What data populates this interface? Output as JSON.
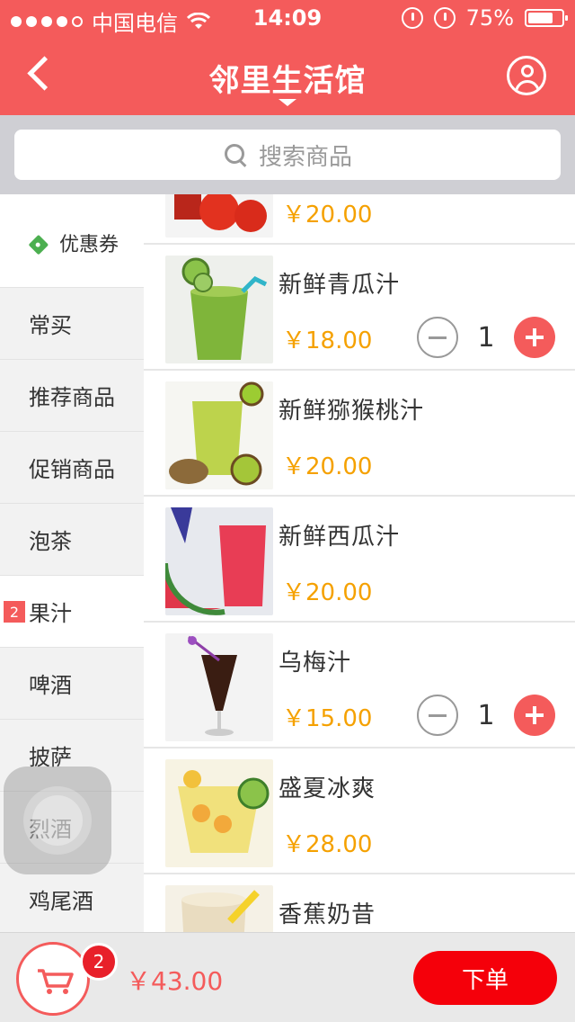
{
  "status_bar": {
    "carrier": "中国电信",
    "time": "14:09",
    "battery": "75%",
    "battery_level": 0.75
  },
  "nav": {
    "title": "邻里生活馆"
  },
  "search": {
    "placeholder": "搜索商品"
  },
  "sidebar": {
    "coupon_label": "优惠券",
    "items": [
      {
        "label": "常买",
        "badge": ""
      },
      {
        "label": "推荐商品",
        "badge": ""
      },
      {
        "label": "促销商品",
        "badge": ""
      },
      {
        "label": "泡茶",
        "badge": ""
      },
      {
        "label": "果汁",
        "badge": "2",
        "active": true
      },
      {
        "label": "啤酒",
        "badge": ""
      },
      {
        "label": "披萨",
        "badge": ""
      },
      {
        "label": "烈酒",
        "badge": ""
      },
      {
        "label": "鸡尾酒",
        "badge": ""
      }
    ]
  },
  "products": [
    {
      "name": "",
      "price": "￥20.00",
      "qty": null
    },
    {
      "name": "新鲜青瓜汁",
      "price": "￥18.00",
      "qty": "1"
    },
    {
      "name": "新鲜猕猴桃汁",
      "price": "￥20.00",
      "qty": null
    },
    {
      "name": "新鲜西瓜汁",
      "price": "￥20.00",
      "qty": null
    },
    {
      "name": "乌梅汁",
      "price": "￥15.00",
      "qty": "1"
    },
    {
      "name": "盛夏冰爽",
      "price": "￥28.00",
      "qty": null
    },
    {
      "name": "香蕉奶昔",
      "price": "",
      "qty": null
    }
  ],
  "cart": {
    "count": "2",
    "total": "￥43.00",
    "order_label": "下单"
  },
  "colors": {
    "accent": "#f45b5b",
    "price": "#f5a100",
    "order_button": "#f5000a"
  }
}
